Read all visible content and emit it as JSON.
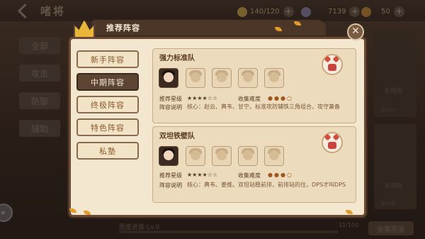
{
  "topbar": {
    "title": "啫将",
    "res1": "140/120",
    "res2": "7139",
    "res3": "50"
  },
  "left_tabs": [
    "全部",
    "攻击",
    "防御",
    "辅助"
  ],
  "bottom": {
    "text": "图鉴进度:Lv.0",
    "count": "31/100",
    "button": "查看图鉴"
  },
  "cards": [
    {
      "label": "未拥有",
      "count": "0/100"
    },
    {
      "label": "未拥有",
      "count": "0/100"
    }
  ],
  "dialog": {
    "title": "推荐阵容",
    "nav": [
      "新手阵容",
      "中期阵容",
      "终极阵容",
      "特色阵容",
      "私塾"
    ],
    "active_nav": 1,
    "teams": [
      {
        "name": "强力标准队",
        "rating_label": "推荐星级",
        "rating": 4,
        "rating_max": 6,
        "difficulty_label": "收集难度",
        "difficulty": 3,
        "difficulty_max": 4,
        "desc_label": "阵容说明",
        "desc": "核心：赵云、典韦、甘宁。标准攻防辅铁三角组合，攻守兼备"
      },
      {
        "name": "双坦铁壁队",
        "rating_label": "推荐星级",
        "rating": 4,
        "rating_max": 6,
        "difficulty_label": "收集难度",
        "difficulty": 3,
        "difficulty_max": 4,
        "desc_label": "阵容说明",
        "desc": "核心：典韦、姜维。双坦站稳前排，前排站的住，DPS才叫DPS"
      }
    ]
  },
  "colors": {
    "panel": "#f4e7cf",
    "accent": "#e9b63a",
    "active_tab": "#5d4433"
  }
}
